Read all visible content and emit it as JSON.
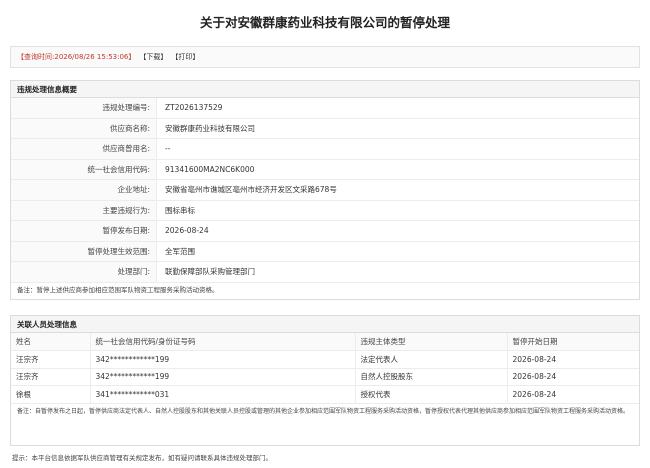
{
  "title": "关于对安徽群康药业科技有限公司的暂停处理",
  "toolbar": {
    "query_time_label": "【查询时间:",
    "query_time_value": "2026/08/26 15:53:06",
    "query_time_close": "】",
    "download": "【下载】",
    "print": "【打印】"
  },
  "summary": {
    "header": "违规处理信息概要",
    "rows": [
      {
        "label": "违规处理编号:",
        "value": "ZT2026137529"
      },
      {
        "label": "供应商名称:",
        "value": "安徽群康药业科技有限公司"
      },
      {
        "label": "供应商曾用名:",
        "value": "--"
      },
      {
        "label": "统一社会信用代码:",
        "value": "91341600MA2NC6K000"
      },
      {
        "label": "企业地址:",
        "value": "安徽省亳州市谯城区亳州市经济开发区文采路678号"
      },
      {
        "label": "主要违规行为:",
        "value": "围标串标"
      },
      {
        "label": "暂停发布日期:",
        "value": "2026-08-24"
      },
      {
        "label": "暂停处理生效范围:",
        "value": "全军范围"
      },
      {
        "label": "处理部门:",
        "value": "联勤保障部队采购管理部门"
      }
    ],
    "note": "备注：暂停上述供应商参加相应范围军队物资工程服务采购活动资格。"
  },
  "related": {
    "header": "关联人员处理信息",
    "columns": [
      "姓名",
      "统一社会信用代码/身份证号码",
      "违规主体类型",
      "暂停开始日期"
    ],
    "rows": [
      [
        "汪宗齐",
        "342************199",
        "法定代表人",
        "2026-08-24"
      ],
      [
        "汪宗齐",
        "342************199",
        "自然人控股股东",
        "2026-08-24"
      ],
      [
        "徐根",
        "341************031",
        "授权代表",
        "2026-08-24"
      ]
    ],
    "note": "备注：自暂停发布之日起，暂停供应商法定代表人、自然人控股股东和其他关联人员控股或管理的其他企业参加相应范围军队物资工程服务采购活动资格，暂停授权代表代理其他供应商参加相应范围军队物资工程服务采购活动资格。"
  },
  "footer": "提示：本平台信息依据军队供应商管理有关规定发布，如有疑问请联系具体违规处理部门。"
}
